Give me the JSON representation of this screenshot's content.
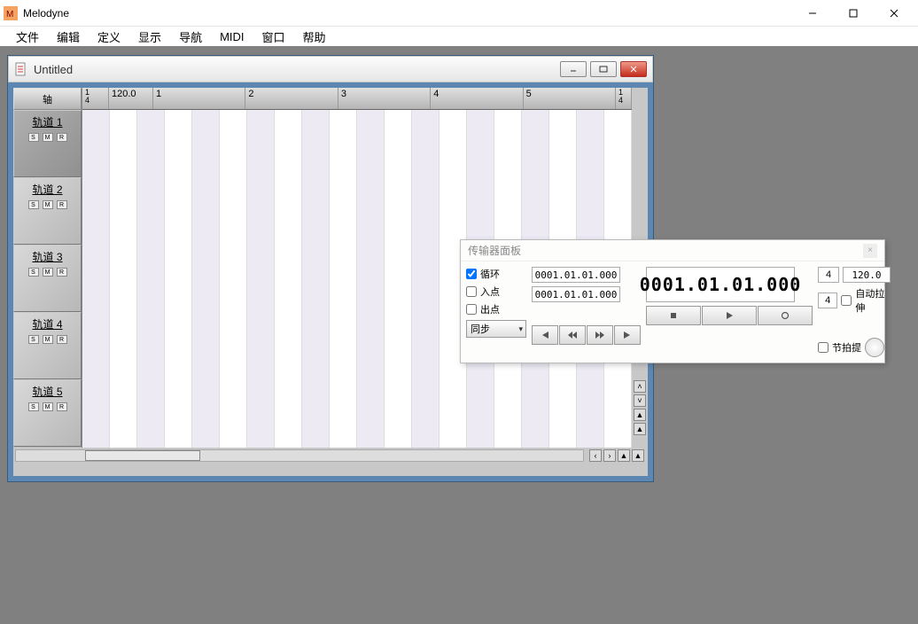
{
  "app": {
    "title": "Melodyne"
  },
  "menus": [
    "文件",
    "编辑",
    "定义",
    "显示",
    "导航",
    "MIDI",
    "窗口",
    "帮助"
  ],
  "doc": {
    "title": "Untitled"
  },
  "ruler": {
    "sig_top": "1",
    "sig_bot": "4",
    "tempo": "120.0",
    "bars": [
      "1",
      "2",
      "3",
      "4",
      "5"
    ],
    "end_top": "1",
    "end_bot": "4"
  },
  "tracks": [
    {
      "name": "轨道 1",
      "selected": true
    },
    {
      "name": "轨道 2",
      "selected": false
    },
    {
      "name": "轨道 3",
      "selected": false
    },
    {
      "name": "轨道 4",
      "selected": false
    },
    {
      "name": "轨道 5",
      "selected": false
    }
  ],
  "track_header": "轴",
  "smr": {
    "s": "S",
    "m": "M",
    "r": "R"
  },
  "transport": {
    "title": "传输器面板",
    "loop_label": "循环",
    "in_label": "入点",
    "out_label": "出点",
    "loop_checked": true,
    "in_checked": false,
    "out_checked": false,
    "in_value": "0001.01.01.000",
    "out_value": "0001.01.01.000",
    "position": "0001.01.01.000",
    "sig_num": "4",
    "sig_den": "4",
    "tempo": "120.0",
    "autostretch_label": "自动拉伸",
    "autostretch_checked": false,
    "sync_label": "同步",
    "click_label": "节拍提",
    "click_checked": false
  }
}
